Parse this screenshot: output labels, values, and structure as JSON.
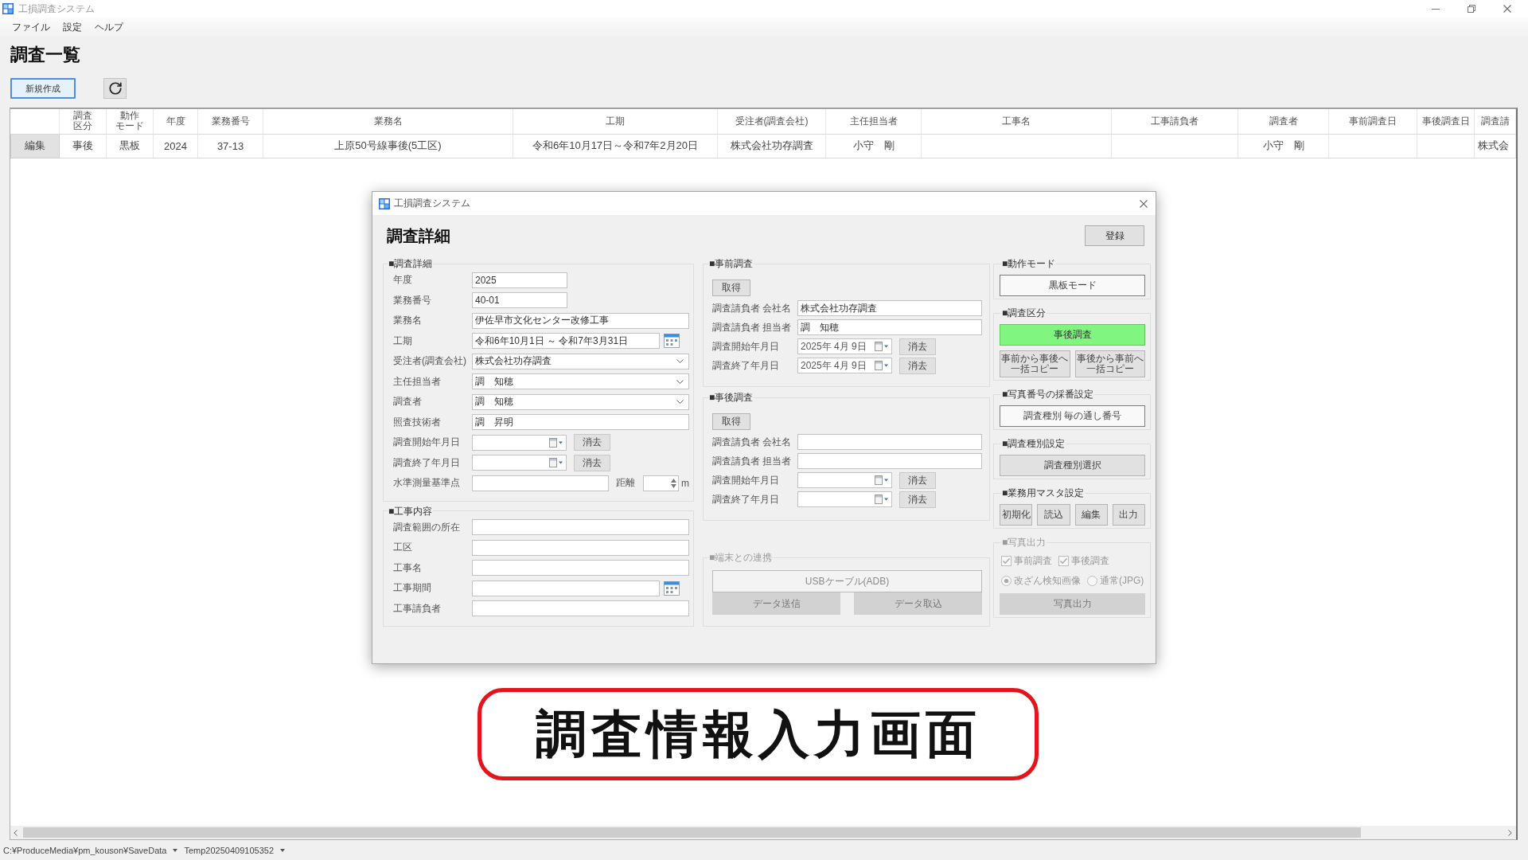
{
  "window": {
    "title": "工損調査システム"
  },
  "menu": [
    {
      "label": "ファイル"
    },
    {
      "label": "設定"
    },
    {
      "label": "ヘルプ"
    }
  ],
  "page_title": "調査一覧",
  "toolbar": {
    "new_button": "新規作成"
  },
  "table": {
    "columns": [
      {
        "kind": "button"
      },
      {
        "kind": "text",
        "lines": [
          "調査",
          "区分"
        ]
      },
      {
        "kind": "text",
        "lines": [
          "動作",
          "モード"
        ]
      },
      {
        "kind": "text",
        "lines": [
          "年度"
        ]
      },
      {
        "kind": "text",
        "lines": [
          "業務番号"
        ]
      },
      {
        "kind": "text",
        "lines": [
          "業務名"
        ]
      },
      {
        "kind": "text",
        "lines": [
          "工期"
        ]
      },
      {
        "kind": "text",
        "lines": [
          "受注者(調査会社)"
        ]
      },
      {
        "kind": "text",
        "lines": [
          "主任担当者"
        ]
      },
      {
        "kind": "text",
        "lines": [
          "工事名"
        ]
      },
      {
        "kind": "text",
        "lines": [
          "工事請負者"
        ]
      },
      {
        "kind": "text",
        "lines": [
          "調査者"
        ]
      },
      {
        "kind": "text",
        "lines": [
          "事前調査日"
        ]
      },
      {
        "kind": "text",
        "lines": [
          "事後調査日"
        ]
      },
      {
        "kind": "text",
        "lines": [
          "調査請"
        ]
      }
    ],
    "rows": [
      {
        "cells": [
          "編集",
          "事後",
          "黒板",
          "2024",
          "37-13",
          "上原50号線事後(5工区)",
          "令和6年10月17日～令和7年2月20日",
          "株式会社功存調査",
          "小守　剛",
          null,
          null,
          "小守　剛",
          null,
          null,
          "株式会"
        ]
      }
    ]
  },
  "dialog": {
    "title": "工損調査システム",
    "heading": "調査詳細",
    "register_button": "登録",
    "panels": [
      {
        "kind": "details",
        "groups": [
          {
            "title": "■調査詳細",
            "disabled": false,
            "items": [
              {
                "kind": "short",
                "label": "年度",
                "value": "2025"
              },
              {
                "kind": "short",
                "label": "業務番号",
                "value": "40-01"
              },
              {
                "kind": "text",
                "label": "業務名",
                "value": "伊佐早市文化センター改修工事"
              },
              {
                "kind": "period",
                "label": "工期",
                "value": "令和6年10月1日 ～ 令和7年3月31日"
              },
              {
                "kind": "select",
                "label": "受注者(調査会社)",
                "value": "株式会社功存調査"
              },
              {
                "kind": "select",
                "label": "主任担当者",
                "value": "調　知穂"
              },
              {
                "kind": "select",
                "label": "調査者",
                "value": "調　知穂"
              },
              {
                "kind": "text",
                "label": "照査技術者",
                "value": "調　昇明"
              },
              {
                "kind": "date",
                "label": "調査開始年月日",
                "clear_button": "消去"
              },
              {
                "kind": "date",
                "label": "調査終了年月日",
                "clear_button": "消去"
              },
              {
                "kind": "distance",
                "label": "水準測量基準点",
                "distance_label": "距離",
                "unit": "m"
              }
            ]
          },
          {
            "title": "■工事内容",
            "disabled": false,
            "items": [
              {
                "kind": "text",
                "label": "調査範囲の所在"
              },
              {
                "kind": "text",
                "label": "工区"
              },
              {
                "kind": "text",
                "label": "工事名"
              },
              {
                "kind": "period",
                "label": "工事期間"
              },
              {
                "kind": "text",
                "label": "工事請負者"
              }
            ]
          }
        ]
      },
      {
        "kind": "surveys",
        "groups": [
          {
            "title": "■事前調査",
            "disabled": false,
            "items": [
              {
                "kind": "buttons",
                "buttons": [
                  {
                    "kind": "compact",
                    "label": "取得"
                  }
                ]
              },
              {
                "kind": "text",
                "label": "調査請負者 会社名",
                "value": "株式会社功存調査"
              },
              {
                "kind": "text",
                "label": "調査請負者 担当者",
                "value": "調　知穂"
              },
              {
                "kind": "date",
                "label": "調査開始年月日",
                "value": "2025年 4月 9日",
                "clear_button": "消去"
              },
              {
                "kind": "date",
                "label": "調査終了年月日",
                "value": "2025年 4月 9日",
                "clear_button": "消去"
              }
            ]
          },
          {
            "title": "■事後調査",
            "disabled": false,
            "items": [
              {
                "kind": "buttons",
                "buttons": [
                  {
                    "kind": "compact",
                    "label": "取得"
                  }
                ]
              },
              {
                "kind": "text",
                "label": "調査請負者 会社名"
              },
              {
                "kind": "text",
                "label": "調査請負者 担当者"
              },
              {
                "kind": "date",
                "label": "調査開始年月日",
                "clear_button": "消去"
              },
              {
                "kind": "date",
                "label": "調査終了年月日",
                "clear_button": "消去"
              }
            ]
          },
          {
            "title": "■端末との連携",
            "disabled": true,
            "items": [
              {
                "kind": "buttons",
                "buttons": [
                  {
                    "kind": "outlined",
                    "label": "USBケーブル(ADB)"
                  }
                ]
              },
              {
                "kind": "buttons",
                "buttons": [
                  {
                    "kind": "plain",
                    "label": "データ送信"
                  },
                  {
                    "kind": "plain",
                    "label": "データ取込"
                  }
                ]
              }
            ]
          }
        ]
      },
      {
        "kind": "settings",
        "groups": [
          {
            "title": "■動作モード",
            "disabled": false,
            "items": [
              {
                "kind": "buttons",
                "buttons": [
                  {
                    "kind": "outlined",
                    "label": "黒板モード"
                  }
                ]
              }
            ]
          },
          {
            "title": "■調査区分",
            "disabled": false,
            "items": [
              {
                "kind": "buttons",
                "buttons": [
                  {
                    "kind": "toggle",
                    "label": "事後調査",
                    "on": true
                  }
                ]
              },
              {
                "kind": "buttons",
                "buttons": [
                  {
                    "kind": "plain",
                    "label": "事前から事後へ一括コピー"
                  },
                  {
                    "kind": "plain",
                    "label": "事後から事前へ一括コピー"
                  }
                ]
              }
            ]
          },
          {
            "title": "■写真番号の採番設定",
            "disabled": false,
            "items": [
              {
                "kind": "buttons",
                "buttons": [
                  {
                    "kind": "outlined",
                    "label": "調査種別 毎の通し番号"
                  }
                ]
              }
            ]
          },
          {
            "title": "■調査種別設定",
            "disabled": false,
            "items": [
              {
                "kind": "buttons",
                "buttons": [
                  {
                    "kind": "plain",
                    "label": "調査種別選択"
                  }
                ]
              }
            ]
          },
          {
            "title": "■業務用マスタ設定",
            "disabled": false,
            "items": [
              {
                "kind": "buttons",
                "buttons": [
                  {
                    "kind": "plain",
                    "label": "初期化"
                  },
                  {
                    "kind": "plain",
                    "label": "読込"
                  },
                  {
                    "kind": "plain",
                    "label": "編集"
                  },
                  {
                    "kind": "plain",
                    "label": "出力"
                  }
                ]
              }
            ]
          },
          {
            "title": "■写真出力",
            "disabled": true,
            "items": [
              {
                "kind": "options",
                "options": [
                  {
                    "kind": "checkbox",
                    "label": "事前調査",
                    "checked": true
                  },
                  {
                    "kind": "checkbox",
                    "label": "事後調査",
                    "checked": true
                  }
                ]
              },
              {
                "kind": "options",
                "options": [
                  {
                    "kind": "radio",
                    "label": "改ざん検知画像",
                    "selected": true
                  },
                  {
                    "kind": "radio",
                    "label": "通常(JPG)",
                    "selected": false
                  }
                ]
              },
              {
                "kind": "buttons",
                "buttons": [
                  {
                    "kind": "plain",
                    "label": "写真出力"
                  }
                ]
              }
            ]
          }
        ]
      }
    ]
  },
  "banner": {
    "text": "調査情報入力画面"
  },
  "status_bar": {
    "items": [
      {
        "text": "C:¥ProduceMedia¥pm_kouson¥SaveData"
      },
      {
        "text": "Temp20250409105352"
      }
    ]
  }
}
